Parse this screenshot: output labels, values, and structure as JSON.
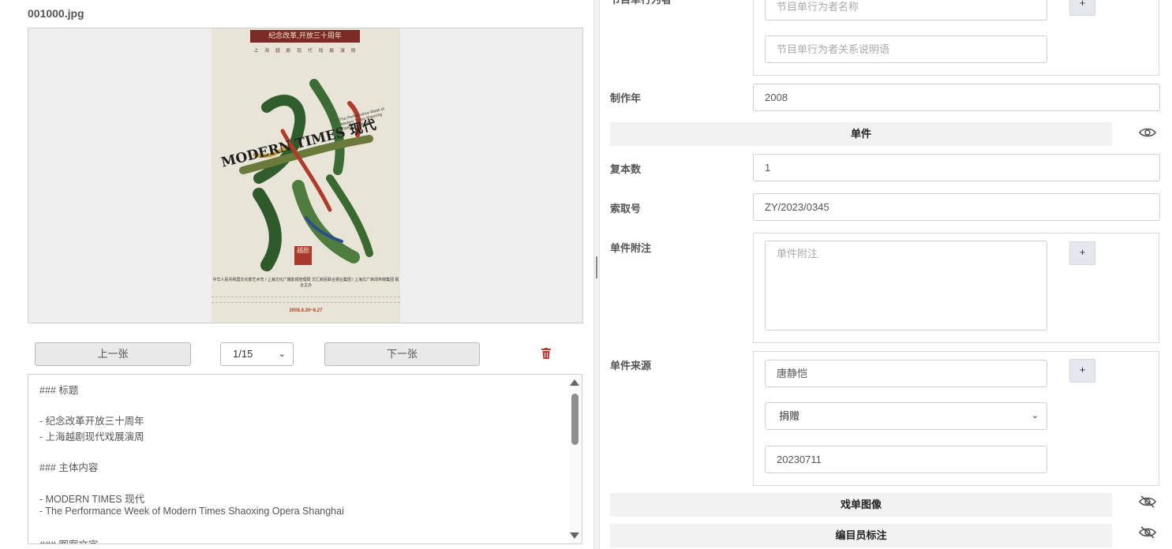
{
  "viewer": {
    "filename": "001000.jpg",
    "poster": {
      "banner": "纪念改革,开放三十周年",
      "subtitle": "上 海 越 剧 现 代 戏 展 演 周",
      "main_title": "MODERN TIMES 现代",
      "english_subtitle": "The Performance Week of Modern Times Shaoxing Opera Shanghai",
      "seal_text": "越剧",
      "organizers": "中华人民共和国文化部艺术司 / 上海文化广播影视管理局 文汇新民联合报业集团 / 上海文广新闻传媒集团 联合主办",
      "dates": "2008.8.20~8.27"
    },
    "prev_label": "上一张",
    "next_label": "下一张",
    "page_value": "1/15",
    "delete_icon": "trash-icon",
    "markdown_lines": [
      "### 标题",
      "- 纪念改革开放三十周年",
      "- 上海越剧现代戏展演周",
      "### 主体内容",
      "- MODERN TIMES 现代",
      "- The Performance Week of Modern Times Shaoxing Opera Shanghai",
      "### 图案文字"
    ]
  },
  "form": {
    "performer_label": "节目单行为者",
    "performer_name_placeholder": "节目单行为者名称",
    "performer_relation_placeholder": "节目单行为者关系说明语",
    "plus_label": "+",
    "year_label": "制作年",
    "year_value": "2008",
    "section_item": "单件",
    "copies_label": "复本数",
    "copies_value": "1",
    "callno_label": "索取号",
    "callno_value": "ZY/2023/0345",
    "note_label": "单件附注",
    "note_placeholder": "单件附注",
    "source_label": "单件来源",
    "source_person": "唐静恺",
    "source_method": "捐赠",
    "source_date": "20230711",
    "section_images": "戏单图像",
    "section_cataloger": "编目员标注"
  },
  "colors": {
    "delete_red": "#d9302c",
    "section_bg": "#f2f2f2",
    "button_bg": "#e9e9e9"
  }
}
